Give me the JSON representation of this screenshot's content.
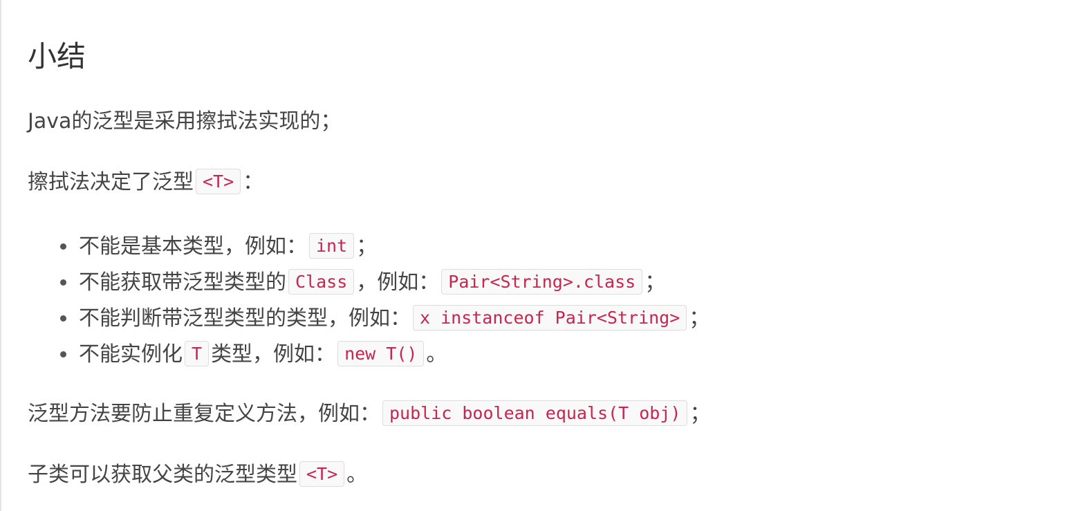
{
  "heading": "小结",
  "p1": {
    "text": "Java的泛型是采用擦拭法实现的；"
  },
  "p2": {
    "text": "擦拭法决定了泛型",
    "code": "<T>",
    "suffix": "："
  },
  "items": [
    {
      "before": "不能是基本类型，例如：",
      "code": "int",
      "after": "；"
    },
    {
      "before": "不能获取带泛型类型的",
      "code": "Class",
      "middle": "，例如：",
      "code2": "Pair<String>.class",
      "after": "；"
    },
    {
      "before": "不能判断带泛型类型的类型，例如：",
      "code": "x instanceof Pair<String>",
      "after": "；"
    },
    {
      "before": "不能实例化",
      "code": "T",
      "middle": "类型，例如：",
      "code2": "new T()",
      "after": "。"
    }
  ],
  "p3": {
    "text": "泛型方法要防止重复定义方法，例如：",
    "code": "public boolean equals(T obj)",
    "suffix": "；"
  },
  "p4": {
    "text": "子类可以获取父类的泛型类型",
    "code": "<T>",
    "suffix": "。"
  }
}
